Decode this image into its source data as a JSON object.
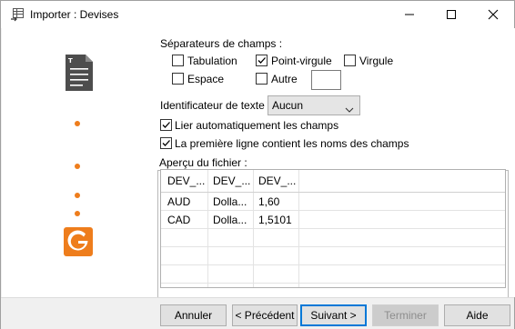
{
  "window": {
    "title": "Importer : Devises",
    "controls": {
      "minimize": "—",
      "maximize": "☐",
      "close": "✕"
    }
  },
  "sidebar": {
    "step_icons": [
      "text-file-icon",
      "step-dot",
      "step-dot",
      "step-dot",
      "step-dot",
      "g-logo-icon"
    ],
    "accent_color": "#ee7d1c"
  },
  "separators": {
    "heading": "Séparateurs de champs :",
    "tabulation": {
      "label": "Tabulation",
      "checked": false
    },
    "point_virgule": {
      "label": "Point-virgule",
      "checked": true
    },
    "virgule": {
      "label": "Virgule",
      "checked": false
    },
    "espace": {
      "label": "Espace",
      "checked": false
    },
    "autre": {
      "label": "Autre",
      "checked": false,
      "value": ""
    }
  },
  "text_qualifier": {
    "label": "Identificateur de texte",
    "selected": "Aucun"
  },
  "options": {
    "auto_link": {
      "label": "Lier automatiquement les champs",
      "checked": true
    },
    "first_row_names": {
      "label": "La première ligne contient les noms des champs",
      "checked": true
    }
  },
  "preview": {
    "label": "Aperçu du fichier :",
    "rows": [
      [
        "DEV_...",
        "DEV_...",
        "DEV_..."
      ],
      [
        "AUD",
        "Dolla...",
        "1,60"
      ],
      [
        "CAD",
        "Dolla...",
        "1,5101"
      ]
    ]
  },
  "buttons": {
    "annuler": "Annuler",
    "precedent": "< Précédent",
    "suivant": "Suivant >",
    "terminer": "Terminer",
    "aide": "Aide"
  }
}
